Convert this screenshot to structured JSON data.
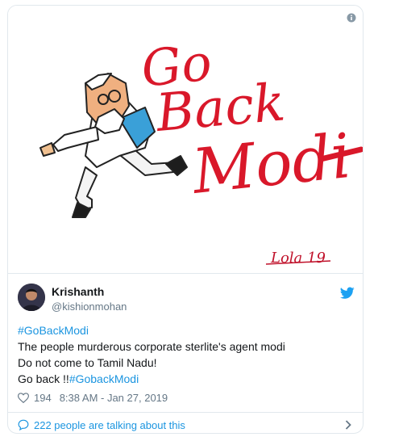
{
  "tweet": {
    "display_name": "Krishanth",
    "handle": "@kishionmohan",
    "hashtag": "#GoBackModi",
    "line1": "The people murderous corporate sterlite's agent modi",
    "line2": "Do not come to Tamil Nadu!",
    "line3_prefix": "Go back !!",
    "line3_hashtag": "#GobackModi",
    "likes": "194",
    "timestamp": "8:38 AM - Jan 27, 2019",
    "talking": "222 people are talking about this"
  },
  "artwork": {
    "text1": "Go",
    "text2": "Back",
    "text3": "Modi",
    "signature": "Lola 19"
  },
  "colors": {
    "link": "#1b95e0",
    "art_red": "#d9182a",
    "twitter_blue": "#1da1f2"
  },
  "icons": [
    "info-icon",
    "twitter-bird-icon",
    "heart-icon",
    "speech-bubble-icon",
    "chevron-right-icon"
  ]
}
